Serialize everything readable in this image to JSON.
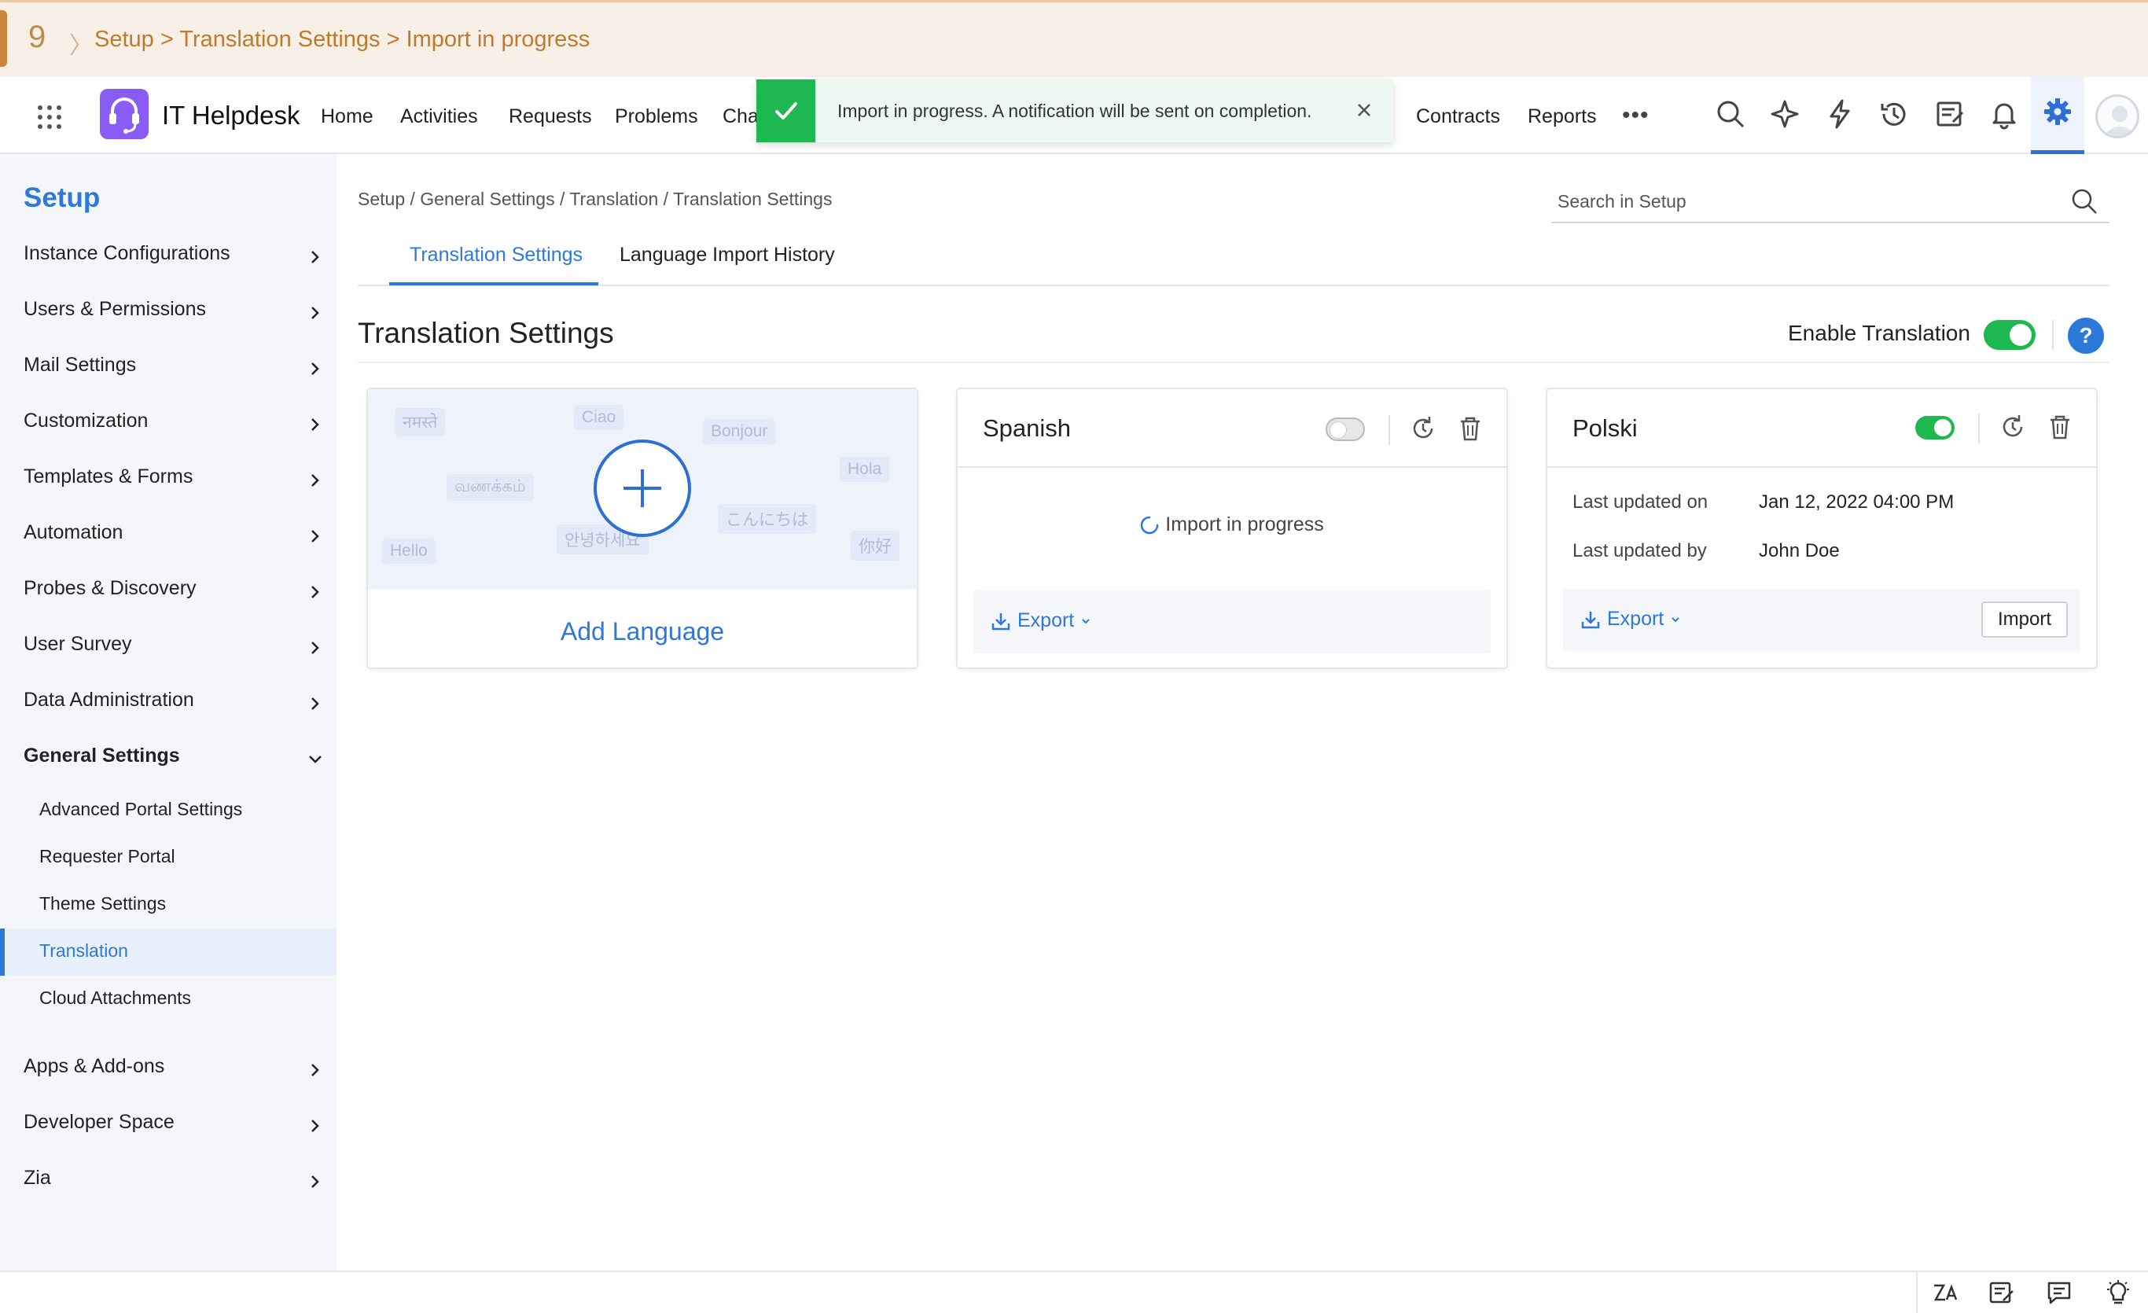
{
  "banner": {
    "step_number": "9",
    "step_text": "Setup > Translation Settings > Import in progress"
  },
  "app": {
    "brand": "IT Helpdesk",
    "nav": [
      "Home",
      "Activities",
      "Requests",
      "Problems",
      "Cha",
      "Contracts",
      "Reports"
    ],
    "more": "•••",
    "icons": [
      "search-icon",
      "magic-icon",
      "lightning-icon",
      "history-icon",
      "tasks-icon",
      "bell-icon",
      "gear-icon",
      "avatar"
    ]
  },
  "toast": {
    "message": "Import in progress. A notification will be sent on completion.",
    "color": "#1db84f"
  },
  "sidebar": {
    "title": "Setup",
    "items": [
      "Instance Configurations",
      "Users & Permissions",
      "Mail Settings",
      "Customization",
      "Templates & Forms",
      "Automation",
      "Probes & Discovery",
      "User Survey",
      "Data Administration",
      "General Settings"
    ],
    "sub_items": [
      "Advanced Portal Settings",
      "Requester Portal",
      "Theme Settings",
      "Translation",
      "Cloud Attachments"
    ],
    "active_sub": "Translation",
    "bottom_items": [
      "Apps & Add-ons",
      "Developer Space",
      "Zia"
    ]
  },
  "main": {
    "breadcrumb": "Setup / General Settings / Translation / Translation Settings",
    "search_placeholder": "Search in Setup",
    "tabs": [
      "Translation Settings",
      "Language Import History"
    ],
    "title": "Translation Settings",
    "enable_label": "Enable Translation",
    "enable_on": true,
    "help": "?"
  },
  "add_card": {
    "words": [
      "नमस्ते",
      "Ciao",
      "Bonjour",
      "Hola",
      "வணக்கம்",
      "こんにちは",
      "Hello",
      "안녕하세요",
      "你好"
    ],
    "label": "Add Language"
  },
  "spanish_card": {
    "name": "Spanish",
    "enabled": false,
    "status": "Import in progress",
    "export": "Export"
  },
  "polski_card": {
    "name": "Polski",
    "enabled": true,
    "updated_on_label": "Last updated on",
    "updated_on": "Jan 12, 2022 04:00 PM",
    "updated_by_label": "Last updated by",
    "updated_by": "John Doe",
    "export": "Export",
    "import": "Import"
  },
  "colors": {
    "accent": "#2d79d9",
    "success": "#1db84f",
    "banner": "#c07a2e"
  }
}
